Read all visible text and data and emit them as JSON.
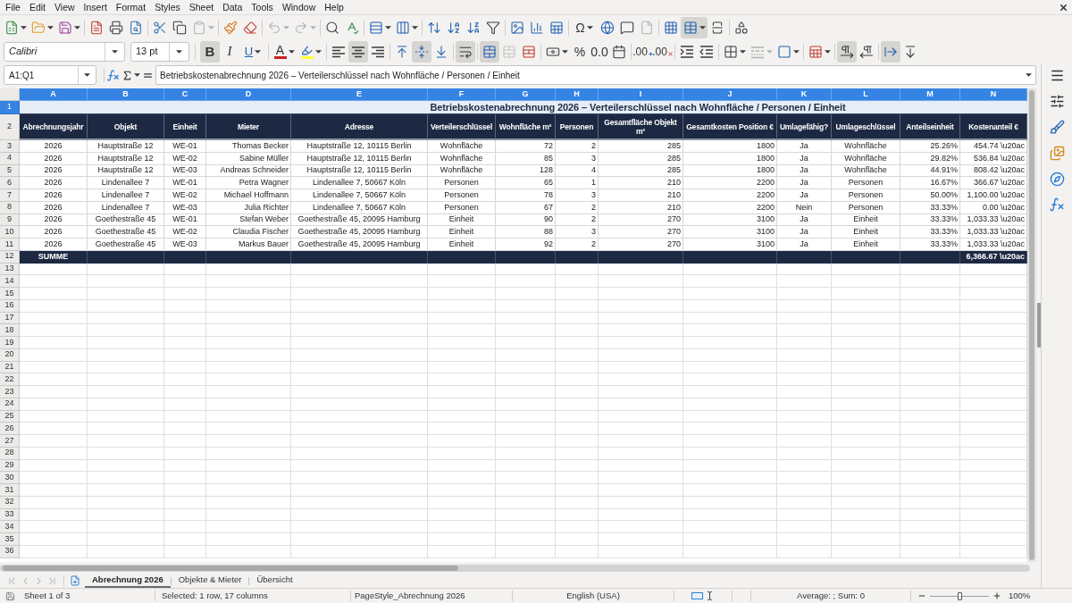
{
  "menu_bar": [
    "File",
    "Edit",
    "View",
    "Insert",
    "Format",
    "Styles",
    "Sheet",
    "Data",
    "Tools",
    "Window",
    "Help"
  ],
  "standard_toolbar": {
    "groups": [
      [
        {
          "kind": "new",
          "on": false,
          "disabled": false
        },
        {
          "kind": "open",
          "on": false,
          "disabled": false
        },
        {
          "kind": "save",
          "on": false,
          "disabled": false
        }
      ],
      [
        {
          "kind": "export_pdf",
          "on": false,
          "disabled": false
        },
        {
          "kind": "print",
          "on": false,
          "disabled": false
        },
        {
          "kind": "print_preview",
          "on": false,
          "disabled": false
        }
      ],
      [
        {
          "kind": "cut",
          "on": false,
          "disabled": false
        },
        {
          "kind": "copy",
          "on": false,
          "disabled": false
        },
        {
          "kind": "paste",
          "on": false,
          "disabled": true
        }
      ],
      [
        {
          "kind": "clone_formatting",
          "on": false,
          "disabled": false
        },
        {
          "kind": "clear_formatting",
          "on": false,
          "disabled": false
        }
      ],
      [
        {
          "kind": "undo",
          "on": false,
          "disabled": true
        },
        {
          "kind": "redo",
          "on": false,
          "disabled": true
        }
      ],
      [
        {
          "kind": "find_replace",
          "on": false,
          "disabled": false
        },
        {
          "kind": "spelling",
          "on": false,
          "disabled": false
        }
      ],
      [
        {
          "kind": "row",
          "on": false,
          "disabled": false
        },
        {
          "kind": "column",
          "on": false,
          "disabled": false
        }
      ],
      [
        {
          "kind": "sort",
          "on": false,
          "disabled": false
        },
        {
          "kind": "sort_ascending",
          "on": false,
          "disabled": false
        },
        {
          "kind": "sort_descending",
          "on": false,
          "disabled": false
        },
        {
          "kind": "autofilter",
          "on": false,
          "disabled": false
        }
      ],
      [
        {
          "kind": "image",
          "on": false,
          "disabled": false
        },
        {
          "kind": "chart",
          "on": false,
          "disabled": false
        },
        {
          "kind": "pivot_table",
          "on": false,
          "disabled": false
        }
      ],
      [
        {
          "kind": "special_character",
          "glyph": "Ω",
          "on": false,
          "disabled": false
        },
        {
          "kind": "hyperlink",
          "on": false,
          "disabled": false
        },
        {
          "kind": "comment",
          "on": false,
          "disabled": false
        },
        {
          "kind": "header_footer",
          "on": false,
          "disabled": true
        }
      ],
      [
        {
          "kind": "print_area",
          "on": false,
          "disabled": false
        },
        {
          "kind": "freeze",
          "on": true,
          "disabled": false
        },
        {
          "kind": "split_window",
          "on": false,
          "disabled": false
        }
      ],
      [
        {
          "kind": "draw_functions",
          "on": false,
          "disabled": false
        }
      ]
    ]
  },
  "formatting_toolbar": {
    "font_name": "Calibri",
    "font_size": "13 pt",
    "groups": [
      [
        {
          "kind": "bold",
          "glyph": "B",
          "on": true,
          "disabled": false
        },
        {
          "kind": "italic",
          "glyph": "I",
          "on": false,
          "disabled": false
        },
        {
          "kind": "underline",
          "glyph": "U",
          "on": false,
          "disabled": false
        }
      ],
      [
        {
          "kind": "font_color",
          "glyph": "A",
          "on": false,
          "disabled": false
        },
        {
          "kind": "highlight",
          "on": false,
          "disabled": false
        }
      ],
      [
        {
          "kind": "align_left",
          "on": false,
          "disabled": false
        },
        {
          "kind": "align_center",
          "on": true,
          "disabled": false
        },
        {
          "kind": "align_right",
          "on": false,
          "disabled": false
        }
      ],
      [
        {
          "kind": "align_top",
          "on": false,
          "disabled": false
        },
        {
          "kind": "align_middle",
          "on": true,
          "disabled": false
        },
        {
          "kind": "align_bottom",
          "on": false,
          "disabled": false
        }
      ],
      [
        {
          "kind": "wrap",
          "on": true,
          "disabled": false
        }
      ],
      [
        {
          "kind": "merge_center",
          "on": true,
          "disabled": false
        },
        {
          "kind": "merge",
          "on": false,
          "disabled": true
        },
        {
          "kind": "unmerge",
          "on": false,
          "disabled": false
        }
      ],
      [
        {
          "kind": "number_format",
          "on": false,
          "disabled": false
        },
        {
          "kind": "percent",
          "glyph": "%",
          "on": false,
          "disabled": false
        },
        {
          "kind": "standard",
          "glyph": "0.0",
          "on": false,
          "disabled": false
        },
        {
          "kind": "date",
          "on": false,
          "disabled": false
        }
      ],
      [
        {
          "kind": "add_decimal",
          "glyph": ".00",
          "on": false,
          "disabled": false
        },
        {
          "kind": "delete_decimal",
          "glyph": ".00",
          "on": false,
          "disabled": false
        }
      ],
      [
        {
          "kind": "indent_increase",
          "on": false,
          "disabled": false
        },
        {
          "kind": "indent_decrease",
          "on": false,
          "disabled": false
        }
      ],
      [
        {
          "kind": "borders",
          "on": false,
          "disabled": false
        },
        {
          "kind": "border_style",
          "on": false,
          "disabled": true
        },
        {
          "kind": "border_color",
          "on": false,
          "disabled": false
        }
      ],
      [
        {
          "kind": "conditional",
          "on": false,
          "disabled": false
        }
      ],
      [
        {
          "kind": "left_to_right",
          "on": true,
          "disabled": false
        },
        {
          "kind": "right_to_left",
          "on": false,
          "disabled": false
        }
      ],
      [
        {
          "kind": "text_horizontal",
          "on": true,
          "disabled": false
        },
        {
          "kind": "text_vertical",
          "on": false,
          "disabled": false
        }
      ]
    ]
  },
  "formula_bar": {
    "name_box": "A1:Q1",
    "formula": "Betriebskostenabrechnung 2026 – Verteilerschlüssel nach Wohnfläche / Personen / Einheit"
  },
  "sheet": {
    "columns": [
      {
        "label": "A",
        "selected": true
      },
      {
        "label": "B",
        "selected": true
      },
      {
        "label": "C",
        "selected": true
      },
      {
        "label": "D",
        "selected": true
      },
      {
        "label": "E",
        "selected": true
      },
      {
        "label": "F",
        "selected": true
      },
      {
        "label": "G",
        "selected": true
      },
      {
        "label": "H",
        "selected": true
      },
      {
        "label": "I",
        "selected": true
      },
      {
        "label": "J",
        "selected": true
      },
      {
        "label": "K",
        "selected": true
      },
      {
        "label": "L",
        "selected": true
      },
      {
        "label": "M",
        "selected": true
      },
      {
        "label": "N",
        "selected": true
      }
    ],
    "rows": [
      {
        "number": "1",
        "selected": true,
        "kind": "title",
        "title": "Betriebskostenabrechnung 2026 – Verteilerschlüssel nach Wohnfläche / Personen / Einheit"
      },
      {
        "number": "2",
        "selected": false,
        "kind": "header",
        "cells": [
          "Abrechnungsjahr",
          "Objekt",
          "Einheit",
          "Mieter",
          "Adresse",
          "Verteilerschlüssel",
          "Wohnfläche m²",
          "Personen",
          "Gesamtfläche Objekt m²",
          "Gesamtkosten Position €",
          "Umlagefähig?",
          "Umlageschlüssel",
          "Anteilseinheit",
          "Kostenanteil €"
        ]
      },
      {
        "number": "3",
        "selected": false,
        "kind": "data",
        "cells": [
          "2026",
          "Hauptstraße 12",
          "WE-01",
          "Thomas Becker",
          "Hauptstraße 12, 10115 Berlin",
          "Wohnfläche",
          "72",
          "2",
          "285",
          "1800",
          "Ja",
          "Wohnfläche",
          "25.26%",
          "454.74 \\u20ac"
        ]
      },
      {
        "number": "4",
        "selected": false,
        "kind": "data",
        "cells": [
          "2026",
          "Hauptstraße 12",
          "WE-02",
          "Sabine Müller",
          "Hauptstraße 12, 10115 Berlin",
          "Wohnfläche",
          "85",
          "3",
          "285",
          "1800",
          "Ja",
          "Wohnfläche",
          "29.82%",
          "536.84 \\u20ac"
        ]
      },
      {
        "number": "5",
        "selected": false,
        "kind": "data",
        "cells": [
          "2026",
          "Hauptstraße 12",
          "WE-03",
          "Andreas Schneider",
          "Hauptstraße 12, 10115 Berlin",
          "Wohnfläche",
          "128",
          "4",
          "285",
          "1800",
          "Ja",
          "Wohnfläche",
          "44.91%",
          "808.42 \\u20ac"
        ]
      },
      {
        "number": "6",
        "selected": false,
        "kind": "data",
        "cells": [
          "2026",
          "Lindenallee 7",
          "WE-01",
          "Petra Wagner",
          "Lindenallee 7, 50667 Köln",
          "Personen",
          "65",
          "1",
          "210",
          "2200",
          "Ja",
          "Personen",
          "16.67%",
          "366.67 \\u20ac"
        ]
      },
      {
        "number": "7",
        "selected": false,
        "kind": "data",
        "cells": [
          "2026",
          "Lindenallee 7",
          "WE-02",
          "Michael Hoffmann",
          "Lindenallee 7, 50667 Köln",
          "Personen",
          "78",
          "3",
          "210",
          "2200",
          "Ja",
          "Personen",
          "50.00%",
          "1,100.00 \\u20ac"
        ]
      },
      {
        "number": "8",
        "selected": false,
        "kind": "data",
        "cells": [
          "2026",
          "Lindenallee 7",
          "WE-03",
          "Julia Richter",
          "Lindenallee 7, 50667 Köln",
          "Personen",
          "67",
          "2",
          "210",
          "2200",
          "Nein",
          "Personen",
          "33.33%",
          "0.00 \\u20ac"
        ]
      },
      {
        "number": "9",
        "selected": false,
        "kind": "data",
        "cells": [
          "2026",
          "Goethestraße 45",
          "WE-01",
          "Stefan Weber",
          "Goethestraße 45, 20095 Hamburg",
          "Einheit",
          "90",
          "2",
          "270",
          "3100",
          "Ja",
          "Einheit",
          "33.33%",
          "1,033.33 \\u20ac"
        ]
      },
      {
        "number": "10",
        "selected": false,
        "kind": "data",
        "cells": [
          "2026",
          "Goethestraße 45",
          "WE-02",
          "Claudia Fischer",
          "Goethestraße 45, 20095 Hamburg",
          "Einheit",
          "88",
          "3",
          "270",
          "3100",
          "Ja",
          "Einheit",
          "33.33%",
          "1,033.33 \\u20ac"
        ]
      },
      {
        "number": "11",
        "selected": false,
        "kind": "data",
        "cells": [
          "2026",
          "Goethestraße 45",
          "WE-03",
          "Markus Bauer",
          "Goethestraße 45, 20095 Hamburg",
          "Einheit",
          "92",
          "2",
          "270",
          "3100",
          "Ja",
          "Einheit",
          "33.33%",
          "1,033.33 \\u20ac"
        ]
      },
      {
        "number": "12",
        "selected": false,
        "kind": "total",
        "label": "SUMME",
        "total": "6,366.67 \\u20ac"
      },
      {
        "number": "13",
        "selected": false,
        "kind": "empty"
      },
      {
        "number": "14",
        "selected": false,
        "kind": "empty"
      },
      {
        "number": "15",
        "selected": false,
        "kind": "empty"
      },
      {
        "number": "16",
        "selected": false,
        "kind": "empty"
      },
      {
        "number": "17",
        "selected": false,
        "kind": "empty"
      },
      {
        "number": "18",
        "selected": false,
        "kind": "empty"
      },
      {
        "number": "19",
        "selected": false,
        "kind": "empty"
      },
      {
        "number": "20",
        "selected": false,
        "kind": "empty"
      },
      {
        "number": "21",
        "selected": false,
        "kind": "empty"
      },
      {
        "number": "22",
        "selected": false,
        "kind": "empty"
      },
      {
        "number": "23",
        "selected": false,
        "kind": "empty"
      },
      {
        "number": "24",
        "selected": false,
        "kind": "empty"
      },
      {
        "number": "25",
        "selected": false,
        "kind": "empty"
      },
      {
        "number": "26",
        "selected": false,
        "kind": "empty"
      },
      {
        "number": "27",
        "selected": false,
        "kind": "empty"
      },
      {
        "number": "28",
        "selected": false,
        "kind": "empty"
      },
      {
        "number": "29",
        "selected": false,
        "kind": "empty"
      },
      {
        "number": "30",
        "selected": false,
        "kind": "empty"
      },
      {
        "number": "31",
        "selected": false,
        "kind": "empty"
      },
      {
        "number": "32",
        "selected": false,
        "kind": "empty"
      },
      {
        "number": "33",
        "selected": false,
        "kind": "empty"
      },
      {
        "number": "34",
        "selected": false,
        "kind": "empty"
      },
      {
        "number": "35",
        "selected": false,
        "kind": "empty"
      },
      {
        "number": "36",
        "selected": false,
        "kind": "empty"
      }
    ]
  },
  "sheet_tabs": [
    {
      "label": "Abrechnung 2026",
      "selected": true
    },
    {
      "label": "Objekte & Mieter",
      "selected": false
    },
    {
      "label": "Übersicht",
      "selected": false
    }
  ],
  "status_bar": {
    "sheet": "Sheet 1 of 3",
    "selection": "Selected: 1 row, 17 columns",
    "page_style": "PageStyle_Abrechnung 2026",
    "language": "English (USA)",
    "summary": "Average: ; Sum: 0",
    "zoom": {
      "level": 0.5,
      "reading": "100%"
    }
  }
}
